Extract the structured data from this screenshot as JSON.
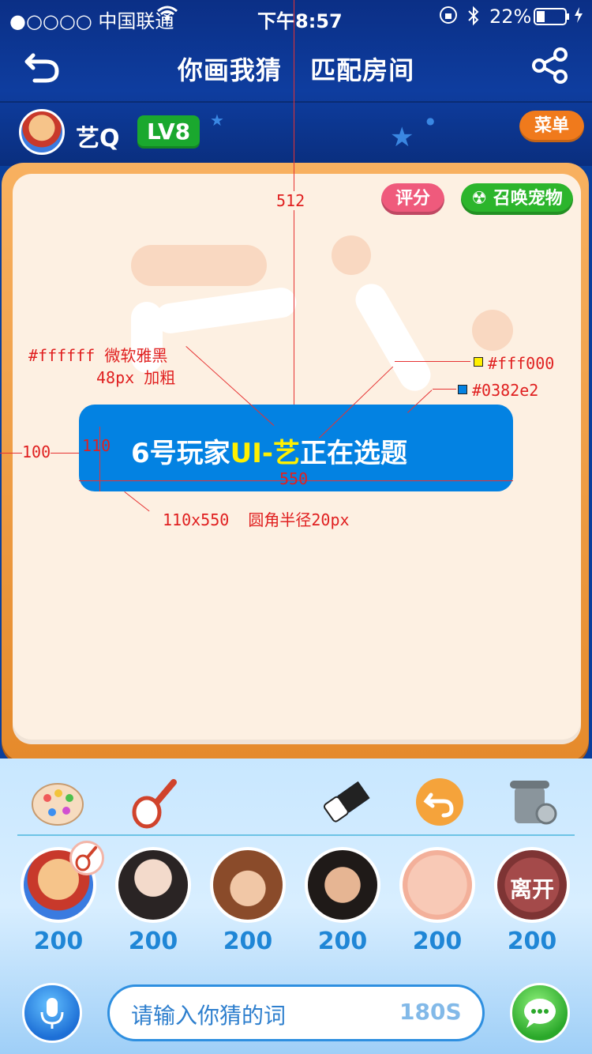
{
  "status": {
    "carrier": "●○○○○ 中国联通",
    "time": "下午8:57",
    "battery": "22%"
  },
  "nav": {
    "title_game": "你画我猜",
    "title_room": "匹配房间"
  },
  "user": {
    "name": "艺Q",
    "level": "LV8",
    "menu_label": "菜单"
  },
  "board": {
    "rate_label": "评分",
    "summon_pet_label": "召唤宠物",
    "topic_prefix": "6号玩家",
    "topic_player": "UI-艺",
    "topic_suffix": "正在选题"
  },
  "annotations": {
    "top_distance": "512",
    "font_spec_line1": "#ffffff 微软雅黑",
    "font_spec_line2": "48px 加粗",
    "yellow_color": "#fff000",
    "blue_color": "#0382e2",
    "left_distance": "100",
    "height": "110",
    "width": "550",
    "size_spec": "110x550  圆角半径20px"
  },
  "players": [
    {
      "score": "200"
    },
    {
      "score": "200"
    },
    {
      "score": "200"
    },
    {
      "score": "200"
    },
    {
      "score": "200"
    },
    {
      "score": "200",
      "status": "离开"
    }
  ],
  "input": {
    "placeholder": "请输入你猜的词",
    "timer": "180S"
  },
  "colors": {
    "topic_bg": "#0382e2",
    "highlight": "#fff000",
    "menu": "#f07a1c",
    "level": "#1aa82e"
  }
}
